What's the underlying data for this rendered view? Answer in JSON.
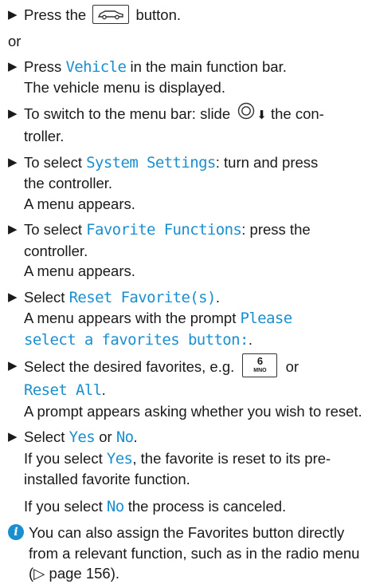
{
  "arrow": "▶",
  "car_key_icon": "car-button-icon",
  "controller_icon": "controller-icon",
  "step1": {
    "pre": "Press the",
    "post": "button."
  },
  "or": "or",
  "step2": {
    "pre": "Press",
    "term": "Vehicle",
    "post": "in the main function bar.",
    "result": "The vehicle menu is displayed."
  },
  "step3": {
    "pre": "To switch to the menu bar: slide",
    "down_arrow": "⬇",
    "post": "the con-",
    "post2": "troller."
  },
  "step4": {
    "pre": "To select",
    "term": "System Settings",
    "post": ": turn and press",
    "post2": "the controller.",
    "result": "A menu appears."
  },
  "step5": {
    "pre": "To select",
    "term": "Favorite Functions",
    "post": ": press the",
    "post2": "controller.",
    "result": "A menu appears."
  },
  "step6": {
    "pre": "Select",
    "term": "Reset Favorite(s)",
    "post": ".",
    "result_pre": "A menu appears with the prompt",
    "term2a": "Please",
    "term2b": "select a favorites button:",
    "result_post": "."
  },
  "step7": {
    "pre": "Select the desired favorites, e.g.",
    "key_num": "6",
    "key_letters": "MNO",
    "or": "or",
    "term": "Reset All",
    "post": ".",
    "result": "A prompt appears asking whether you wish to reset."
  },
  "step8": {
    "pre": "Select",
    "term_yes": "Yes",
    "or": "or",
    "term_no": "No",
    "post": ".",
    "result_pre": "If you select",
    "result_post": ", the favorite is reset to its pre-installed favorite function."
  },
  "para": {
    "pre": "If you select",
    "post": "the process is canceled."
  },
  "note": {
    "icon": "info-icon",
    "text": "You can also assign the Favorites button directly from a relevant function, such as in the radio menu (▷ page 156)."
  },
  "colors": {
    "accent": "#1a8fcf",
    "text": "#1a1a1a"
  }
}
